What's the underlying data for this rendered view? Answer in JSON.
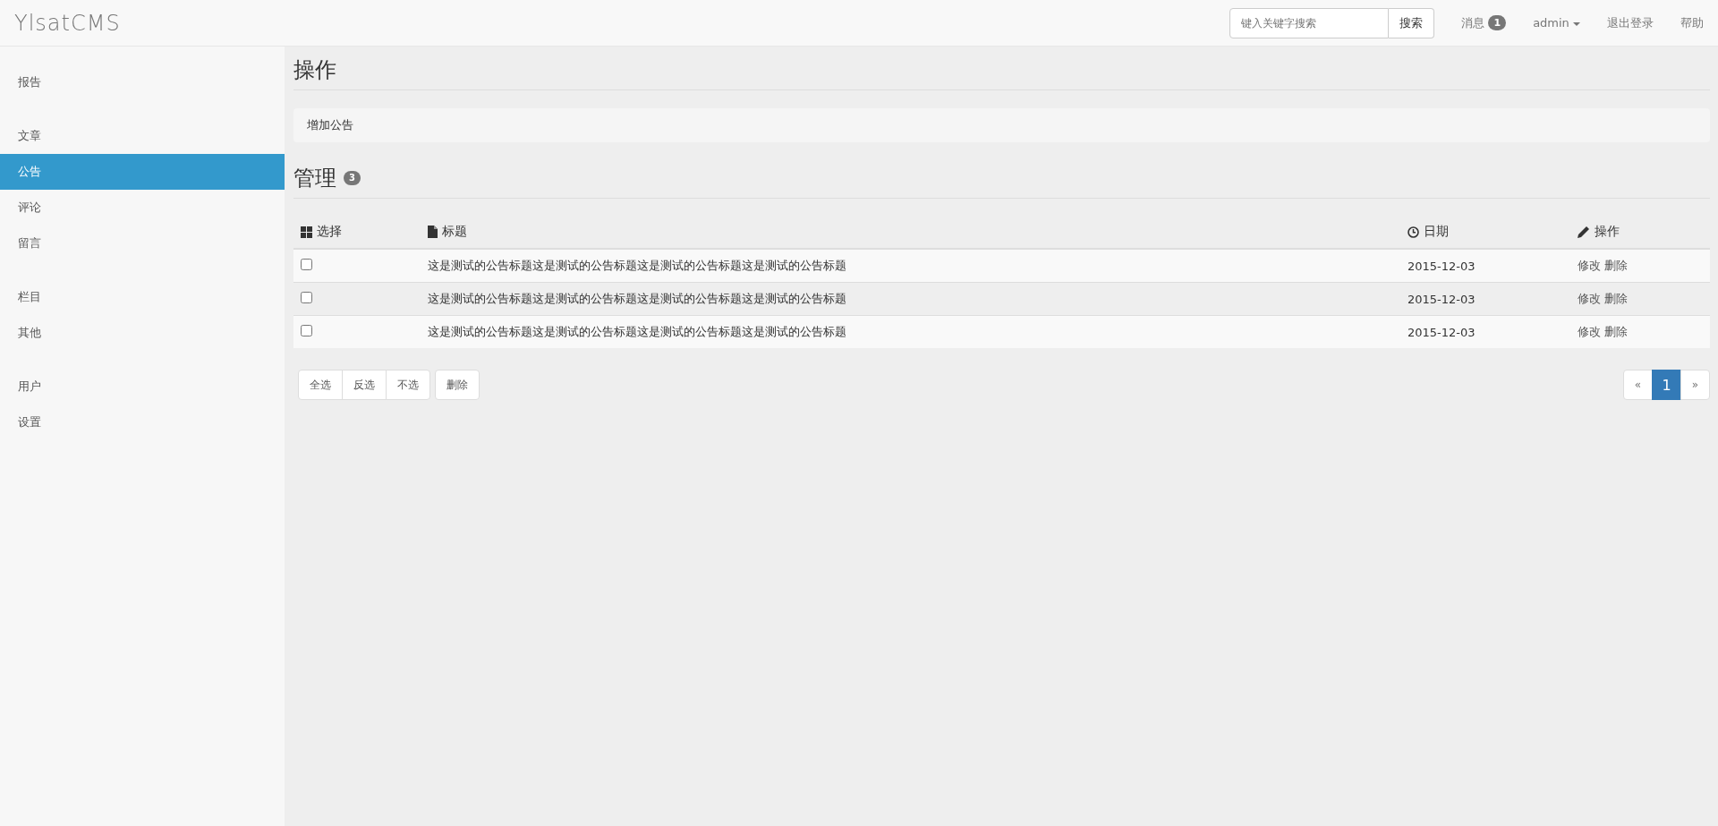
{
  "brand": "YlsatCMS",
  "search": {
    "placeholder": "键入关键字搜索",
    "button": "搜索"
  },
  "nav": {
    "messages": {
      "label": "消息",
      "count": "1"
    },
    "user": "admin",
    "logout": "退出登录",
    "help": "帮助"
  },
  "sidebar": {
    "groups": [
      [
        {
          "label": "报告",
          "selected": false
        }
      ],
      [
        {
          "label": "文章",
          "selected": false
        },
        {
          "label": "公告",
          "selected": true
        },
        {
          "label": "评论",
          "selected": false
        },
        {
          "label": "留言",
          "selected": false
        }
      ],
      [
        {
          "label": "栏目",
          "selected": false
        },
        {
          "label": "其他",
          "selected": false
        }
      ],
      [
        {
          "label": "用户",
          "selected": false
        },
        {
          "label": "设置",
          "selected": false
        }
      ]
    ]
  },
  "operations": {
    "heading": "操作",
    "actions": [
      "增加公告"
    ]
  },
  "manage": {
    "heading": "管理",
    "count": "3"
  },
  "table": {
    "columns": [
      {
        "label": "选择"
      },
      {
        "label": "标题"
      },
      {
        "label": "日期"
      },
      {
        "label": "操作"
      }
    ],
    "rows": [
      {
        "checked": false,
        "title": "这是测试的公告标题这是测试的公告标题这是测试的公告标题这是测试的公告标题",
        "date": "2015-12-03",
        "actions": [
          "修改",
          "删除"
        ]
      },
      {
        "checked": false,
        "title": "这是测试的公告标题这是测试的公告标题这是测试的公告标题这是测试的公告标题",
        "date": "2015-12-03",
        "actions": [
          "修改",
          "删除"
        ]
      },
      {
        "checked": false,
        "title": "这是测试的公告标题这是测试的公告标题这是测试的公告标题这是测试的公告标题",
        "date": "2015-12-03",
        "actions": [
          "修改",
          "删除"
        ]
      }
    ]
  },
  "selection_buttons": [
    "全选",
    "反选",
    "不选"
  ],
  "delete_button": "删除",
  "pagination": {
    "prev": "«",
    "pages": [
      {
        "label": "1",
        "selected": true
      }
    ],
    "next": "»"
  }
}
